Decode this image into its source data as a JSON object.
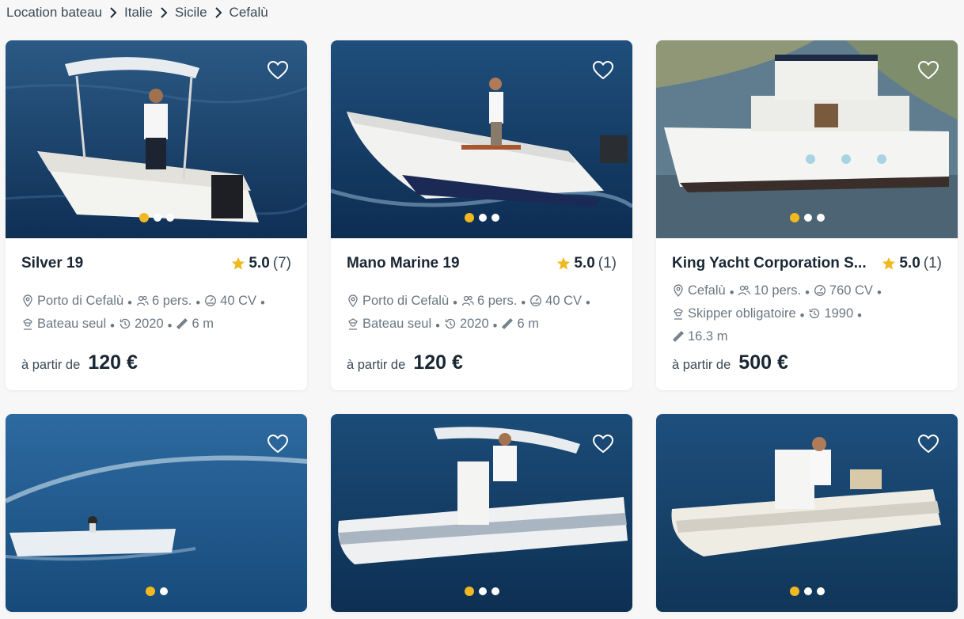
{
  "breadcrumb": [
    "Location bateau",
    "Italie",
    "Sicile",
    "Cefalù"
  ],
  "colors": {
    "accent": "#f2b821",
    "text": "#1a2733",
    "muted": "#6b7782"
  },
  "price_prefix": "à partir de",
  "cards": [
    {
      "title": "Silver 19",
      "score": "5.0",
      "count": "(7)",
      "specs_line1": [
        "Porto di Cefalù",
        "6 pers.",
        "40 CV"
      ],
      "specs_line2": [
        "Bateau seul",
        "2020",
        "6 m"
      ],
      "price": "120 €",
      "dots": 3,
      "active_dot": 0
    },
    {
      "title": "Mano Marine 19",
      "score": "5.0",
      "count": "(1)",
      "specs_line1": [
        "Porto di Cefalù",
        "6 pers.",
        "40 CV"
      ],
      "specs_line2": [
        "Bateau seul",
        "2020",
        "6 m"
      ],
      "price": "120 €",
      "dots": 3,
      "active_dot": 0
    },
    {
      "title": "King Yacht Corporation S...",
      "score": "5.0",
      "count": "(1)",
      "specs_line1": [
        "Cefalù",
        "10 pers.",
        "760 CV"
      ],
      "specs_line2": [
        "Skipper obligatoire",
        "1990"
      ],
      "specs_line3": [
        "16.3 m"
      ],
      "price": "500 €",
      "dots": 3,
      "active_dot": 0
    },
    {
      "dots": 2,
      "active_dot": 0
    },
    {
      "dots": 3,
      "active_dot": 0
    },
    {
      "dots": 3,
      "active_dot": 0
    }
  ]
}
